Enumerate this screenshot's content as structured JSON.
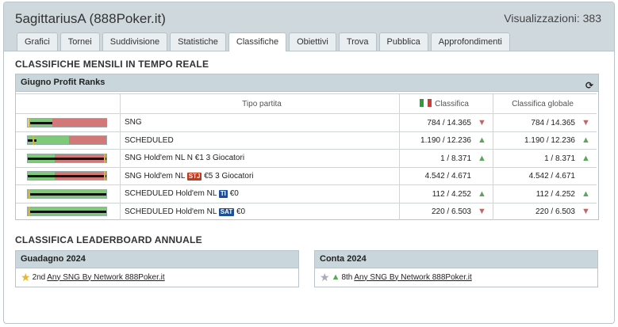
{
  "header": {
    "title": "5agittariusA (888Poker.it)",
    "views_label": "Visualizzazioni: 383"
  },
  "tabs": [
    {
      "label": "Grafici"
    },
    {
      "label": "Tornei"
    },
    {
      "label": "Suddivisione"
    },
    {
      "label": "Statistiche"
    },
    {
      "label": "Classifiche",
      "active": true
    },
    {
      "label": "Obiettivi"
    },
    {
      "label": "Trova"
    },
    {
      "label": "Pubblica"
    },
    {
      "label": "Approfondimenti"
    }
  ],
  "monthly": {
    "section_title": "CLASSIFICHE MENSILI IN TEMPO REALE",
    "panel_title": "Giugno Profit Ranks",
    "columns": {
      "type": "Tipo partita",
      "rank": "Classifica",
      "global": "Classifica globale"
    },
    "colors": {
      "up": "#5aa65a",
      "down": "#c06868"
    },
    "rows": [
      {
        "type": "SNG",
        "rank": "784 / 14.365",
        "rank_trend": "down",
        "global": "784 / 14.365",
        "global_trend": "down"
      },
      {
        "type": "SCHEDULED",
        "rank": "1.190 / 12.236",
        "rank_trend": "up",
        "global": "1.190 / 12.236",
        "global_trend": "up"
      },
      {
        "type": "SNG Hold'em NL N  €1 3 Giocatori",
        "rank": "1 / 8.371",
        "rank_trend": "up",
        "global": "1 / 8.371",
        "global_trend": "up"
      },
      {
        "type_prefix": "SNG Hold'em NL",
        "badge": "STJ",
        "type_suffix": "€5 3 Giocatori",
        "rank": "4.542 / 4.671",
        "rank_trend": "none",
        "global": "4.542 / 4.671",
        "global_trend": "none"
      },
      {
        "type_prefix": "SCHEDULED Hold'em NL",
        "badge": "TI",
        "type_suffix": "€0",
        "rank": "112 / 4.252",
        "rank_trend": "up",
        "global": "112 / 4.252",
        "global_trend": "up"
      },
      {
        "type_prefix": "SCHEDULED Hold'em NL",
        "badge": "SAT",
        "type_suffix": "€0",
        "rank": "220 / 6.503",
        "rank_trend": "down",
        "global": "220 / 6.503",
        "global_trend": "down"
      }
    ]
  },
  "annual": {
    "section_title": "CLASSIFICA LEADERBOARD ANNUALE",
    "left": {
      "title": "Guadagno 2024",
      "place": "2nd",
      "link": "Any SNG By Network 888Poker.it"
    },
    "right": {
      "title": "Conta 2024",
      "place": "8th",
      "link": "Any SNG By Network 888Poker.it"
    }
  }
}
